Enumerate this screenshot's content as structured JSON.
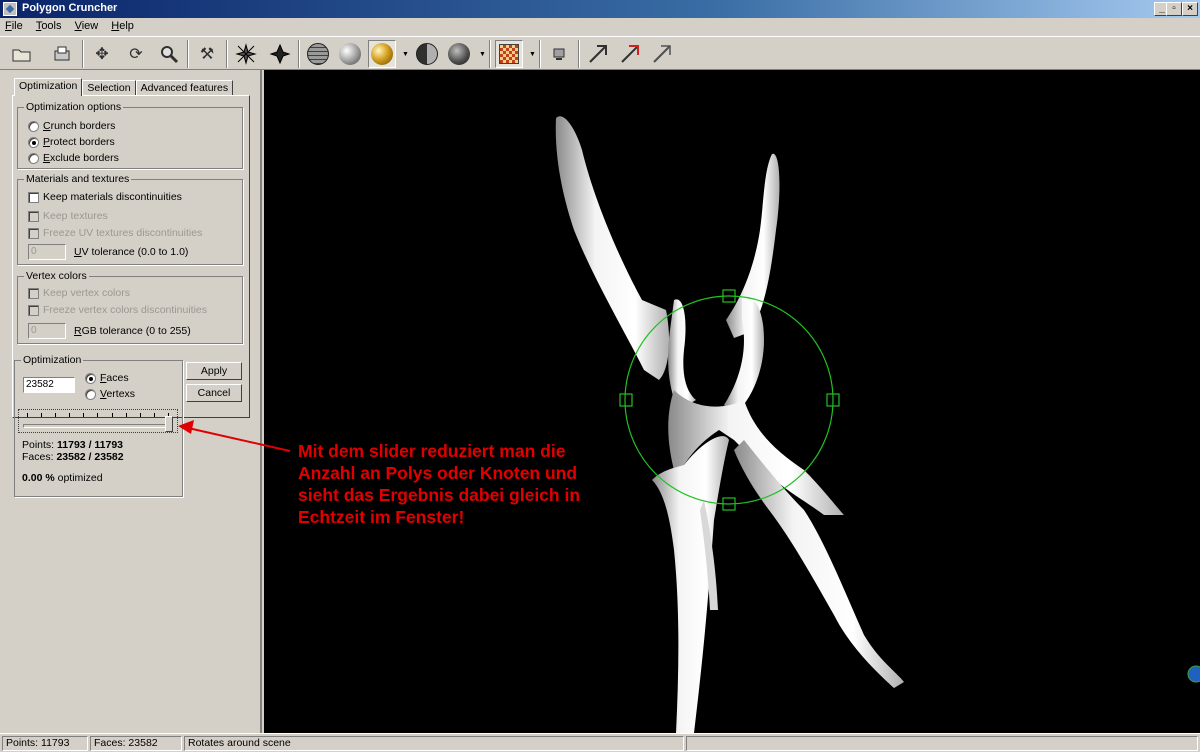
{
  "window": {
    "title": "Polygon Cruncher"
  },
  "menu": [
    "File",
    "Tools",
    "View",
    "Help"
  ],
  "toolbar": {
    "icons": [
      "open-folder-icon",
      "save-disk-icon",
      "move-arrows-icon",
      "rotate-icon",
      "zoom-magnifier-icon",
      "tools-hammer-icon",
      "vertex-star-icon",
      "vertex-star-filled-icon",
      "wireframe-sphere-icon",
      "flat-sphere-icon",
      "gold-smooth-sphere-icon",
      "half-shaded-sphere-icon",
      "dark-sphere-icon",
      "texture-checker-icon",
      "screen-icon",
      "axis-arrow-icon",
      "axis-arrow-red-icon",
      "axis-arrow-light-icon"
    ]
  },
  "tabs": [
    "Optimization",
    "Selection",
    "Advanced features"
  ],
  "optimization_options": {
    "legend": "Optimization options",
    "options": [
      "Crunch borders",
      "Protect borders",
      "Exclude borders"
    ],
    "selected": "Protect borders"
  },
  "materials": {
    "legend": "Materials and textures",
    "keep_materials": "Keep materials discontinuities",
    "keep_textures": "Keep textures",
    "freeze_uv": "Freeze UV textures discontinuities",
    "uv_value": "0",
    "uv_label": "UV tolerance (0.0 to 1.0)"
  },
  "vertex_colors": {
    "legend": "Vertex colors",
    "keep": "Keep vertex colors",
    "freeze": "Freeze vertex colors discontinuities",
    "rgb_value": "0",
    "rgb_label": "RGB tolerance (0 to 255)"
  },
  "optimization": {
    "legend": "Optimization",
    "count": "23582",
    "faces_label": "Faces",
    "vertexs_label": "Vertexs",
    "mode": "Faces",
    "slider_level": 1.0,
    "points_label": "Points:",
    "points_value": "11793 / 11793",
    "faces_stat_label": "Faces:",
    "faces_value": "23582 / 23582",
    "percent": "0.00 %",
    "percent_suffix": "optimized",
    "apply": "Apply",
    "cancel": "Cancel"
  },
  "annotation": "Mit dem slider reduziert man die Anzahl an Polys oder Knoten und sieht das Ergebnis dabei gleich in Echtzeit im Fenster!",
  "colors": {
    "annotation": "#e00000",
    "gizmo": "#22c022",
    "viewport": "#000000",
    "titlebar": "#0a246a"
  },
  "status": {
    "points": "Points: 11793",
    "faces": "Faces: 23582",
    "hint": "Rotates around scene"
  }
}
